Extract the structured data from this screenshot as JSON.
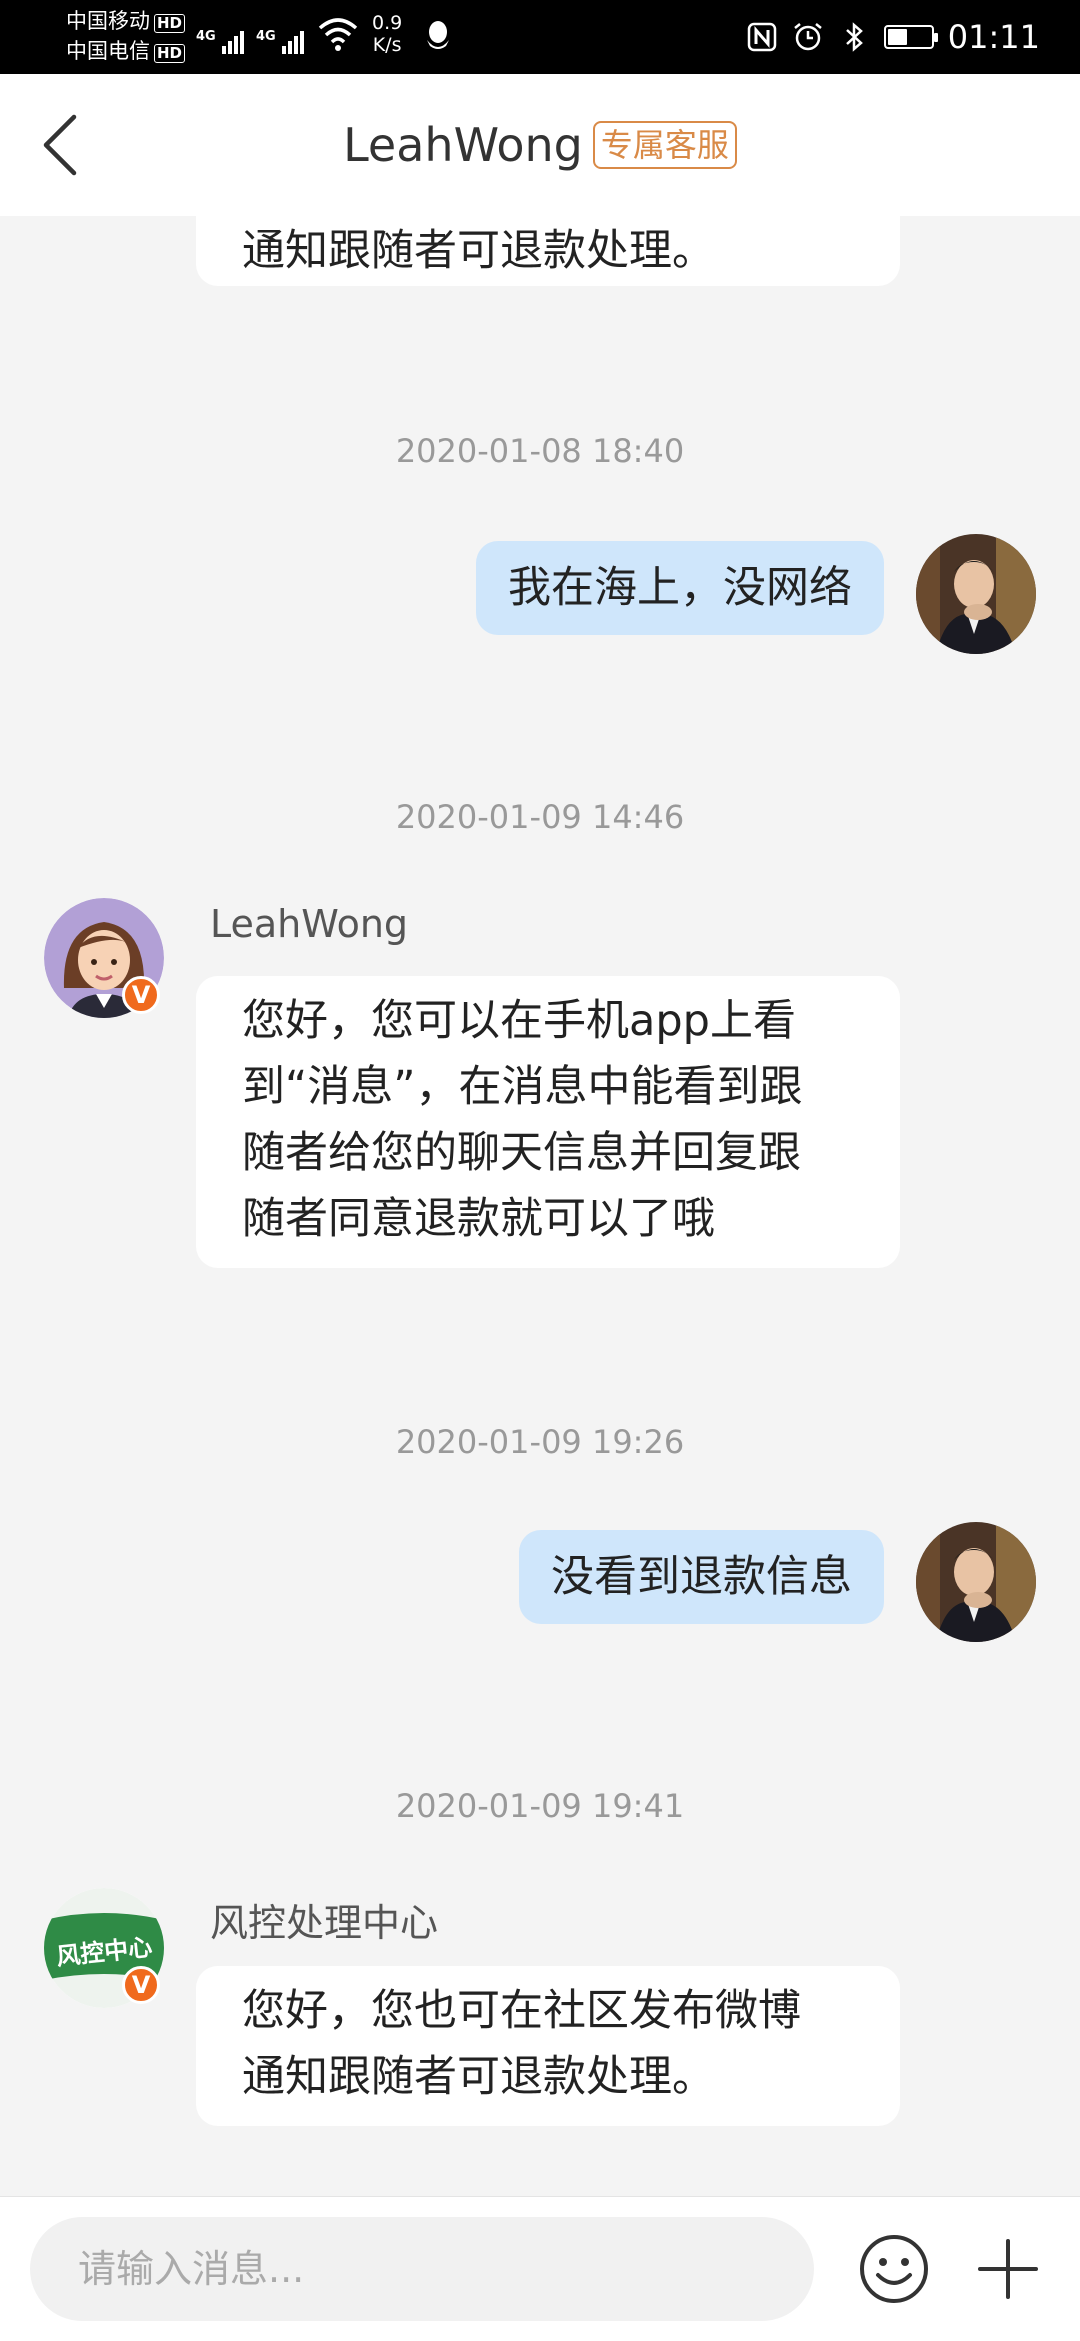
{
  "status_bar": {
    "carrier1": "中国移动",
    "carrier2": "中国电信",
    "hd": "HD",
    "net1": "4G",
    "net2": "4G",
    "speed_value": "0.9",
    "speed_unit": "K/s",
    "time": "01:11",
    "battery_level": 0.45,
    "icons": [
      "nfc-icon",
      "alarm-icon",
      "bluetooth-icon",
      "battery-icon",
      "wifi-icon",
      "qq-icon",
      "signal-icon"
    ]
  },
  "header": {
    "title": "LeahWong",
    "badge": "专属客服",
    "badge_color": "#d98a47",
    "back_icon": "chevron-left-icon"
  },
  "chat": {
    "partial_top_text": "通知跟随者可退款处理。",
    "messages": [
      {
        "time": "2020-01-08 18:40",
        "side": "mine",
        "text": "我在海上，没网络"
      },
      {
        "time": "2020-01-09 14:46",
        "side": "theirs",
        "sender": "LeahWong",
        "verified": "V",
        "text": "您好，您可以在手机app上看\n到“消息”，在消息中能看到跟\n随者给您的聊天信息并回复跟\n随者同意退款就可以了哦"
      },
      {
        "time": "2020-01-09 19:26",
        "side": "mine",
        "text": "没看到退款信息"
      },
      {
        "time": "2020-01-09 19:41",
        "side": "theirs",
        "sender": "风控处理中心",
        "verified": "V",
        "avatar_text": "风控中心",
        "text": "您好，您也可在社区发布微博\n通知跟随者可退款处理。"
      }
    ]
  },
  "colors": {
    "mine_bubble": "#cfe6fb",
    "their_bubble": "#ffffff",
    "background": "#f4f4f4",
    "verified_badge": "#f06a1d"
  },
  "input_bar": {
    "placeholder": "请输入消息...",
    "emoji_icon": "smiley-icon",
    "plus_icon": "plus-icon"
  }
}
